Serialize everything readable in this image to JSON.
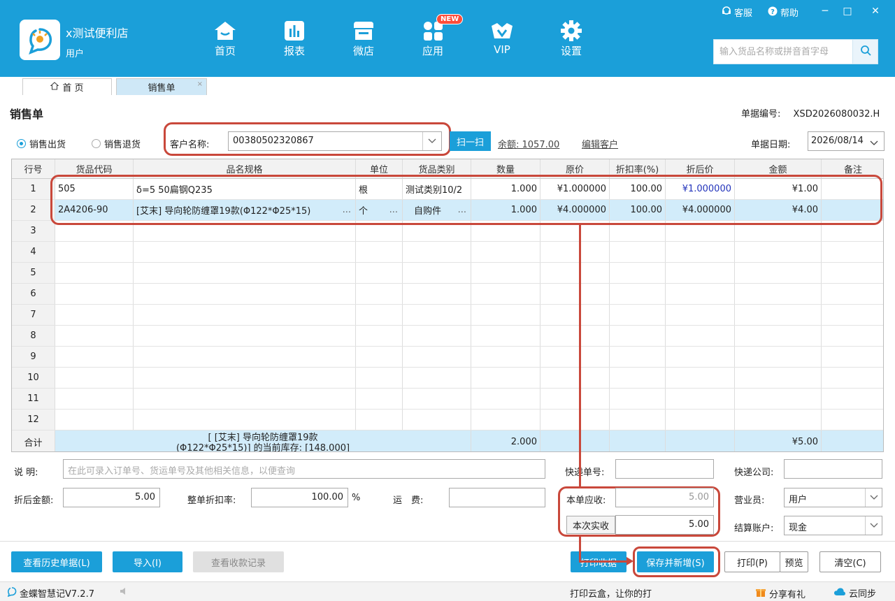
{
  "app": {
    "shop_name": "x测试便利店",
    "user_role": "用户",
    "nav": [
      {
        "label": "首页",
        "icon": "home-icon"
      },
      {
        "label": "报表",
        "icon": "report-icon"
      },
      {
        "label": "微店",
        "icon": "shop-icon"
      },
      {
        "label": "应用",
        "icon": "apps-icon",
        "badge": "NEW"
      },
      {
        "label": "VIP",
        "icon": "vip-crown-icon"
      },
      {
        "label": "设置",
        "icon": "gear-icon"
      }
    ],
    "service_label": "客服",
    "help_label": "帮助",
    "search_placeholder": "输入货品名称或拼音首字母"
  },
  "tabs": [
    {
      "label": "首 页",
      "icon": "home-icon"
    },
    {
      "label": "销售单",
      "close": "×"
    }
  ],
  "form": {
    "title": "销售单",
    "doc_no_label": "单据编号:",
    "doc_no": "XSD2026080032.H",
    "radio_out": "销售出货",
    "radio_return": "销售退货",
    "customer_label": "客户名称:",
    "customer_value": "00380502320867",
    "scan_label": "扫一扫",
    "balance": "余额: 1057.00",
    "edit_customer": "编辑客户",
    "date_label": "单据日期:",
    "date_value": "2026/08/14"
  },
  "grid": {
    "headers": [
      "行号",
      "货品代码",
      "品名规格",
      "单位",
      "货品类别",
      "数量",
      "原价",
      "折扣率(%)",
      "折后价",
      "金额",
      "备注"
    ],
    "rows": [
      {
        "no": "1",
        "code": "505",
        "name": "δ=5 50扁钢Q235",
        "unit": "根",
        "cat": "测试类别10/2",
        "qty": "1.000",
        "price": "¥1.000000",
        "rate": "100.00",
        "dprice": "¥1.000000",
        "amt": "¥1.00",
        "note": ""
      },
      {
        "no": "2",
        "code": "2A4206-90",
        "name": "[艾末] 导向轮防缠罩19款(Φ122*Φ25*15)",
        "unit": "个",
        "cat": "自购件",
        "qty": "1.000",
        "price": "¥4.000000",
        "rate": "100.00",
        "dprice": "¥4.000000",
        "amt": "¥4.00",
        "note": ""
      }
    ],
    "empty_rows": [
      "3",
      "4",
      "5",
      "6",
      "7",
      "8",
      "9",
      "10",
      "11",
      "12"
    ],
    "total_label": "合计",
    "total_name_line1": "[ [艾末] 导向轮防缠罩19款",
    "total_name_line2": "(Φ122*Φ25*15)] 的当前库存: [148.000]",
    "total_qty": "2.000",
    "total_amt": "¥5.00",
    "ellipsis": "..."
  },
  "bottom": {
    "remark_label": "说 明:",
    "remark_placeholder": "在此可录入订单号、货运单号及其他相关信息，以便查询",
    "express_no_label": "快递单号:",
    "express_co_label": "快递公司:",
    "discounted_label": "折后金额:",
    "discounted_value": "5.00",
    "whole_rate_label": "整单折扣率:",
    "whole_rate_value": "100.00",
    "pct": "%",
    "freight_label": "运　费:",
    "receivable_label": "本单应收:",
    "receivable_value": "5.00",
    "this_recv_label": "本次实收",
    "this_recv_value": "5.00",
    "salesman_label": "营业员:",
    "salesman_value": "用户",
    "account_label": "结算账户:",
    "account_value": "现金"
  },
  "buttons": {
    "history": "查看历史单据(L)",
    "import": "导入(I)",
    "receipts": "查看收款记录",
    "print_receipt": "打印收据",
    "save_new": "保存并新增(S)",
    "print": "打印(P)",
    "preview": "预览",
    "clear": "清空(C)"
  },
  "status": {
    "version": "金蝶智慧记V7.2.7",
    "promo": "打印云盒，让你的打",
    "share": "分享有礼",
    "sync": "云同步"
  },
  "colors": {
    "brand": "#1b9fd9",
    "highlight_frame": "#c9483b",
    "selected_row": "#d2ecfa"
  }
}
